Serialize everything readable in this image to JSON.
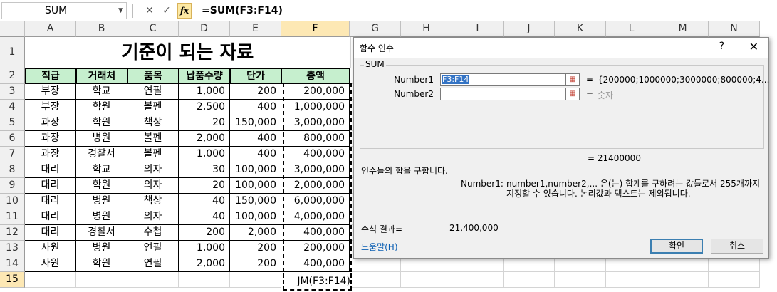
{
  "formula_bar": {
    "name_box": "SUM",
    "cancel_symbol": "✕",
    "enter_symbol": "✓",
    "fx_label": "fx",
    "formula": "=SUM(F3:F14)"
  },
  "columns": [
    "A",
    "B",
    "C",
    "D",
    "E",
    "F",
    "G",
    "H",
    "I",
    "J",
    "K",
    "L",
    "M",
    "N"
  ],
  "rows": [
    "1",
    "2",
    "3",
    "4",
    "5",
    "6",
    "7",
    "8",
    "9",
    "10",
    "11",
    "12",
    "13",
    "14",
    "15"
  ],
  "sheet": {
    "title": "기준이 되는 자료",
    "headers": [
      "직급",
      "거래처",
      "품목",
      "납품수량",
      "단가",
      "총액"
    ],
    "data": [
      [
        "부장",
        "학교",
        "연필",
        "1,000",
        "200",
        "200,000"
      ],
      [
        "부장",
        "학원",
        "볼펜",
        "2,500",
        "400",
        "1,000,000"
      ],
      [
        "과장",
        "학원",
        "책상",
        "20",
        "150,000",
        "3,000,000"
      ],
      [
        "과장",
        "병원",
        "볼펜",
        "2,000",
        "400",
        "800,000"
      ],
      [
        "과장",
        "경찰서",
        "볼펜",
        "1,000",
        "400",
        "400,000"
      ],
      [
        "대리",
        "학교",
        "의자",
        "30",
        "100,000",
        "3,000,000"
      ],
      [
        "대리",
        "학원",
        "의자",
        "20",
        "100,000",
        "2,000,000"
      ],
      [
        "대리",
        "병원",
        "책상",
        "40",
        "150,000",
        "6,000,000"
      ],
      [
        "대리",
        "병원",
        "의자",
        "40",
        "100,000",
        "4,000,000"
      ],
      [
        "대리",
        "경찰서",
        "수첩",
        "200",
        "2,000",
        "400,000"
      ],
      [
        "사원",
        "병원",
        "연필",
        "1,000",
        "200",
        "200,000"
      ],
      [
        "사원",
        "학원",
        "연필",
        "2,000",
        "200",
        "400,000"
      ]
    ],
    "editing_cell_text": "JM(F3:F14)"
  },
  "dialog": {
    "title": "함수 인수",
    "help_symbol": "?",
    "close_symbol": "✕",
    "function_name": "SUM",
    "args": [
      {
        "label": "Number1",
        "value": "F3:F14",
        "equals": "=",
        "result": "{200000;1000000;3000000;800000;4..."
      },
      {
        "label": "Number2",
        "value": "",
        "equals": "=",
        "result": "숫자"
      }
    ],
    "result_line": "=   21400000",
    "description": "인수들의 합을 구합니다.",
    "arg_desc_label": "Number1:",
    "arg_desc_text": "number1,number2,... 은(는) 합계를 구하려는 값들로서 255개까지 지정할 수 있습니다. 논리값과 텍스트는 제외됩니다.",
    "formula_result_label": "수식 결과=",
    "formula_result_value": "21,400,000",
    "help_link": "도움말(H)",
    "ok_label": "확인",
    "cancel_label": "취소"
  },
  "colors": {
    "header_fill": "#c6efce",
    "selection_header": "#fde8b4"
  }
}
